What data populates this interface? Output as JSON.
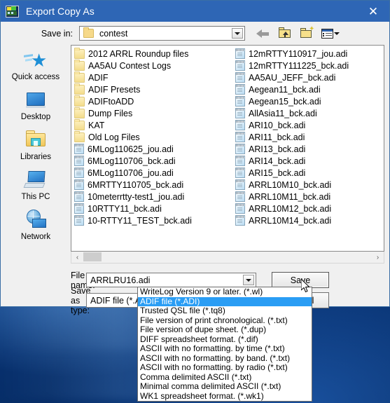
{
  "window": {
    "title": "Export Copy As",
    "icon": "app-icon",
    "close_label": "✕"
  },
  "savein": {
    "label": "Save in:",
    "value": "contest",
    "icon": "folder-icon"
  },
  "toolbar": {
    "back": "back-arrow-icon",
    "up": "up-one-level-icon",
    "newfolder": "new-folder-icon",
    "views": "views-menu-icon"
  },
  "places": {
    "items": [
      {
        "label": "Quick access",
        "icon": "quick-access-icon"
      },
      {
        "label": "Desktop",
        "icon": "desktop-icon"
      },
      {
        "label": "Libraries",
        "icon": "libraries-icon"
      },
      {
        "label": "This PC",
        "icon": "this-pc-icon"
      },
      {
        "label": "Network",
        "icon": "network-icon"
      }
    ]
  },
  "files": [
    {
      "name": "2012 ARRL Roundup files",
      "type": "folder"
    },
    {
      "name": "AA5AU Contest Logs",
      "type": "folder"
    },
    {
      "name": "ADIF",
      "type": "folder"
    },
    {
      "name": "ADIF Presets",
      "type": "folder"
    },
    {
      "name": "ADIFtoADD",
      "type": "folder"
    },
    {
      "name": "Dump Files",
      "type": "folder"
    },
    {
      "name": "KAT",
      "type": "folder"
    },
    {
      "name": "Old Log Files",
      "type": "folder"
    },
    {
      "name": "6MLog110625_jou.adi",
      "type": "file"
    },
    {
      "name": "6MLog110706_bck.adi",
      "type": "file"
    },
    {
      "name": "6MLog110706_jou.adi",
      "type": "file"
    },
    {
      "name": "6MRTTY110705_bck.adi",
      "type": "file"
    },
    {
      "name": "10meterrtty-test1_jou.adi",
      "type": "file"
    },
    {
      "name": "10RTTY11_bck.adi",
      "type": "file"
    },
    {
      "name": "10-RTTY11_TEST_bck.adi",
      "type": "file"
    },
    {
      "name": "12mRTTY110917_jou.adi",
      "type": "file"
    },
    {
      "name": "12mRTTY111225_bck.adi",
      "type": "file"
    },
    {
      "name": "AA5AU_JEFF_bck.adi",
      "type": "file"
    },
    {
      "name": "Aegean11_bck.adi",
      "type": "file"
    },
    {
      "name": "Aegean15_bck.adi",
      "type": "file"
    },
    {
      "name": "AllAsia11_bck.adi",
      "type": "file"
    },
    {
      "name": "ARI10_bck.adi",
      "type": "file"
    },
    {
      "name": "ARI11_bck.adi",
      "type": "file"
    },
    {
      "name": "ARI13_bck.adi",
      "type": "file"
    },
    {
      "name": "ARI14_bck.adi",
      "type": "file"
    },
    {
      "name": "ARI15_bck.adi",
      "type": "file"
    },
    {
      "name": "ARRL10M10_bck.adi",
      "type": "file"
    },
    {
      "name": "ARRL10M11_bck.adi",
      "type": "file"
    },
    {
      "name": "ARRL10M12_bck.adi",
      "type": "file"
    },
    {
      "name": "ARRL10M14_bck.adi",
      "type": "file"
    }
  ],
  "scrollbar": {
    "left_arrow": "‹",
    "right_arrow": "›"
  },
  "form": {
    "filename_label": "File name:",
    "filename_value": "ARRLRU16.adi",
    "filetype_label": "Save as type:",
    "filetype_value": "ADIF file (*.ADI)",
    "save_label": "Save",
    "cancel_label": "Cancel"
  },
  "dropdown": {
    "selected_index": 1,
    "options": [
      "WriteLog Version 9 or later. (*.wl)",
      "ADIF file (*.ADI)",
      "Trusted QSL file (*.tq8)",
      "File version of print chronological. (*.txt)",
      "File version of dupe sheet. (*.dup)",
      "DIFF spreadsheet format. (*.dif)",
      "ASCII with no formatting. by time (*.txt)",
      "ASCII with no formatting. by band. (*.txt)",
      "ASCII with no formatting. by radio (*.txt)",
      "Comma delimited ASCII (*.txt)",
      "Minimal comma delimited ASCII (*.txt)",
      "WK1 spreadsheet format. (*.wk1)"
    ]
  },
  "colors": {
    "titlebar": "#2e66b5",
    "dialog_face": "#f0f0f0",
    "selection": "#2a9df4",
    "desktop": "#0a4594"
  }
}
